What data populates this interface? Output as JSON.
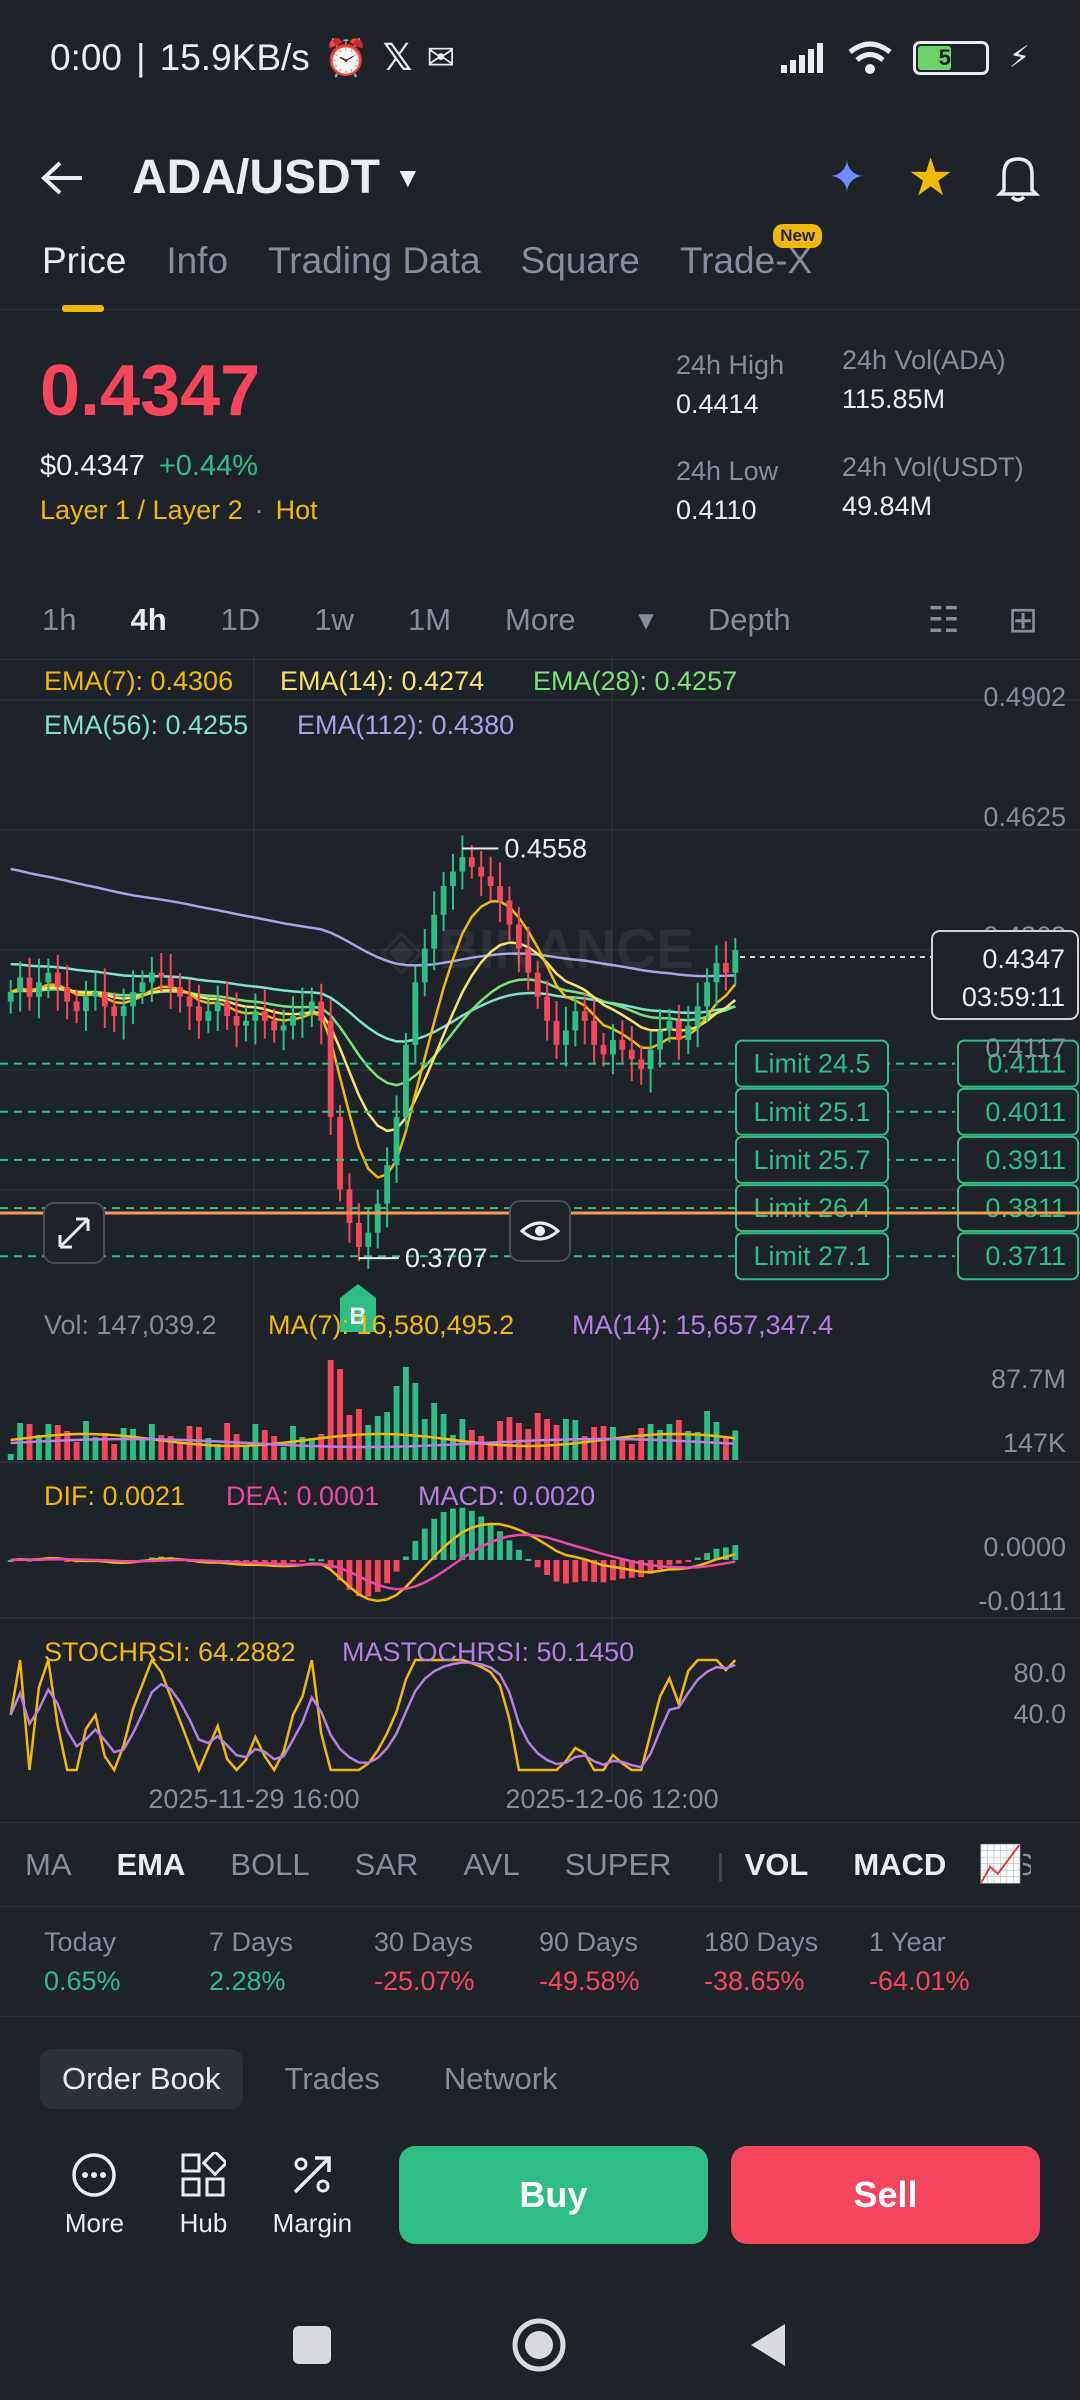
{
  "status": {
    "time": "0:00",
    "speed": "15.9KB/s",
    "battery": "50"
  },
  "header": {
    "pair": "ADA/USDT"
  },
  "tabs": [
    {
      "label": "Price"
    },
    {
      "label": "Info"
    },
    {
      "label": "Trading Data"
    },
    {
      "label": "Square"
    },
    {
      "label": "Trade-X",
      "badge": "New"
    }
  ],
  "ticker": {
    "price": "0.4347",
    "usd": "$0.4347",
    "change": "+0.44%",
    "tag1": "Layer 1 / Layer 2",
    "tag2": "Hot",
    "high_label": "24h High",
    "high": "0.4414",
    "low_label": "24h Low",
    "low": "0.4110",
    "vol_ada_label": "24h Vol(ADA)",
    "vol_ada": "115.85M",
    "vol_usdt_label": "24h Vol(USDT)",
    "vol_usdt": "49.84M"
  },
  "intervals": [
    "1h",
    "4h",
    "1D",
    "1w",
    "1M",
    "More",
    "Depth"
  ],
  "chart_data": {
    "type": "candlestick",
    "ema_labels": {
      "ema7": "EMA(7): 0.4306",
      "ema14": "EMA(14): 0.4274",
      "ema28": "EMA(28): 0.4257",
      "ema56": "EMA(56): 0.4255",
      "ema112": "EMA(112): 0.4380"
    },
    "y_ticks": [
      "0.4902",
      "0.4625",
      "0.4363",
      "0.4117"
    ],
    "price_range": [
      0.362,
      0.496
    ],
    "last_price": "0.4347",
    "countdown": "03:59:11",
    "high_marker": "0.4558",
    "low_marker": "0.3707",
    "high_value": 0.4558,
    "low_value": 0.3707,
    "limits": [
      {
        "label": "Limit 24.5",
        "price": "0.4111",
        "value": 0.4111
      },
      {
        "label": "Limit 25.1",
        "price": "0.4011",
        "value": 0.4011
      },
      {
        "label": "Limit 25.7",
        "price": "0.3911",
        "value": 0.3911
      },
      {
        "label": "Limit 26.4",
        "price": "0.3811",
        "value": 0.3811
      },
      {
        "label": "Limit 27.1",
        "price": "0.3711",
        "value": 0.3711
      }
    ],
    "buy_marker": "B",
    "volume": {
      "vol": "Vol: 147,039.2",
      "ma7": "MA(7): 16,580,495.2",
      "ma14": "MA(14): 15,657,347.4",
      "ticks": [
        "87.7M",
        "147K"
      ]
    },
    "macd": {
      "dif": "DIF: 0.0021",
      "dea": "DEA: 0.0001",
      "macd": "MACD: 0.0020",
      "ticks": [
        "0.0000",
        "-0.0111"
      ]
    },
    "stochrsi": {
      "stoch": "STOCHRSI: 64.2882",
      "ma": "MASTOCHRSI: 50.1450",
      "ticks": [
        "80.0",
        "40.0"
      ]
    },
    "x_labels": [
      "2025-11-29 16:00",
      "2025-12-06 12:00"
    ],
    "closes": [
      0.426,
      0.429,
      0.425,
      0.428,
      0.43,
      0.427,
      0.424,
      0.422,
      0.425,
      0.426,
      0.423,
      0.421,
      0.423,
      0.426,
      0.428,
      0.43,
      0.429,
      0.427,
      0.425,
      0.423,
      0.42,
      0.422,
      0.424,
      0.421,
      0.419,
      0.42,
      0.422,
      0.42,
      0.418,
      0.419,
      0.421,
      0.422,
      0.424,
      0.42,
      0.4,
      0.385,
      0.378,
      0.373,
      0.376,
      0.382,
      0.39,
      0.4,
      0.415,
      0.428,
      0.435,
      0.442,
      0.448,
      0.451,
      0.454,
      0.452,
      0.45,
      0.448,
      0.445,
      0.44,
      0.435,
      0.43,
      0.425,
      0.42,
      0.415,
      0.418,
      0.422,
      0.42,
      0.415,
      0.413,
      0.416,
      0.414,
      0.412,
      0.41,
      0.414,
      0.418,
      0.42,
      0.416,
      0.419,
      0.423,
      0.428,
      0.432,
      0.43,
      0.4347
    ]
  },
  "indicators": [
    "MA",
    "EMA",
    "BOLL",
    "SAR",
    "AVL",
    "SUPER",
    "VOL",
    "MACD",
    "RSI"
  ],
  "performance": [
    {
      "label": "Today",
      "value": "0.65%",
      "up": true
    },
    {
      "label": "7 Days",
      "value": "2.28%",
      "up": true
    },
    {
      "label": "30 Days",
      "value": "-25.07%",
      "up": false
    },
    {
      "label": "90 Days",
      "value": "-49.58%",
      "up": false
    },
    {
      "label": "180 Days",
      "value": "-38.65%",
      "up": false
    },
    {
      "label": "1 Year",
      "value": "-64.01%",
      "up": false
    }
  ],
  "book_tabs": [
    "Order Book",
    "Trades",
    "Network"
  ],
  "actions": {
    "more": "More",
    "hub": "Hub",
    "margin": "Margin",
    "buy": "Buy",
    "sell": "Sell"
  }
}
